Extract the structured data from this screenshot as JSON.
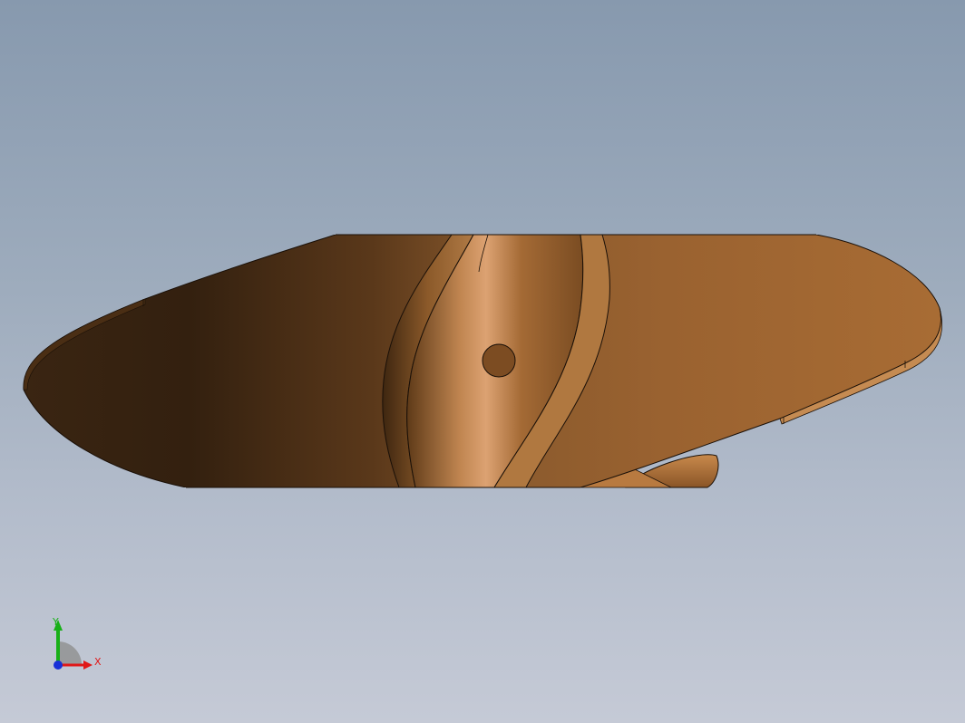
{
  "viewport": {
    "background_top": "#8799ae",
    "background_bottom": "#c5cad6"
  },
  "model": {
    "name": "propeller-blade",
    "material_color": "#a8682f",
    "shadow_color": "#2e1c0e",
    "highlight_color": "#d9a06a",
    "edge_color": "#1a1008"
  },
  "triad": {
    "x_label": "X",
    "y_label": "Y",
    "x_color": "#e01818",
    "y_color": "#18b018",
    "z_color": "#1830d8"
  }
}
